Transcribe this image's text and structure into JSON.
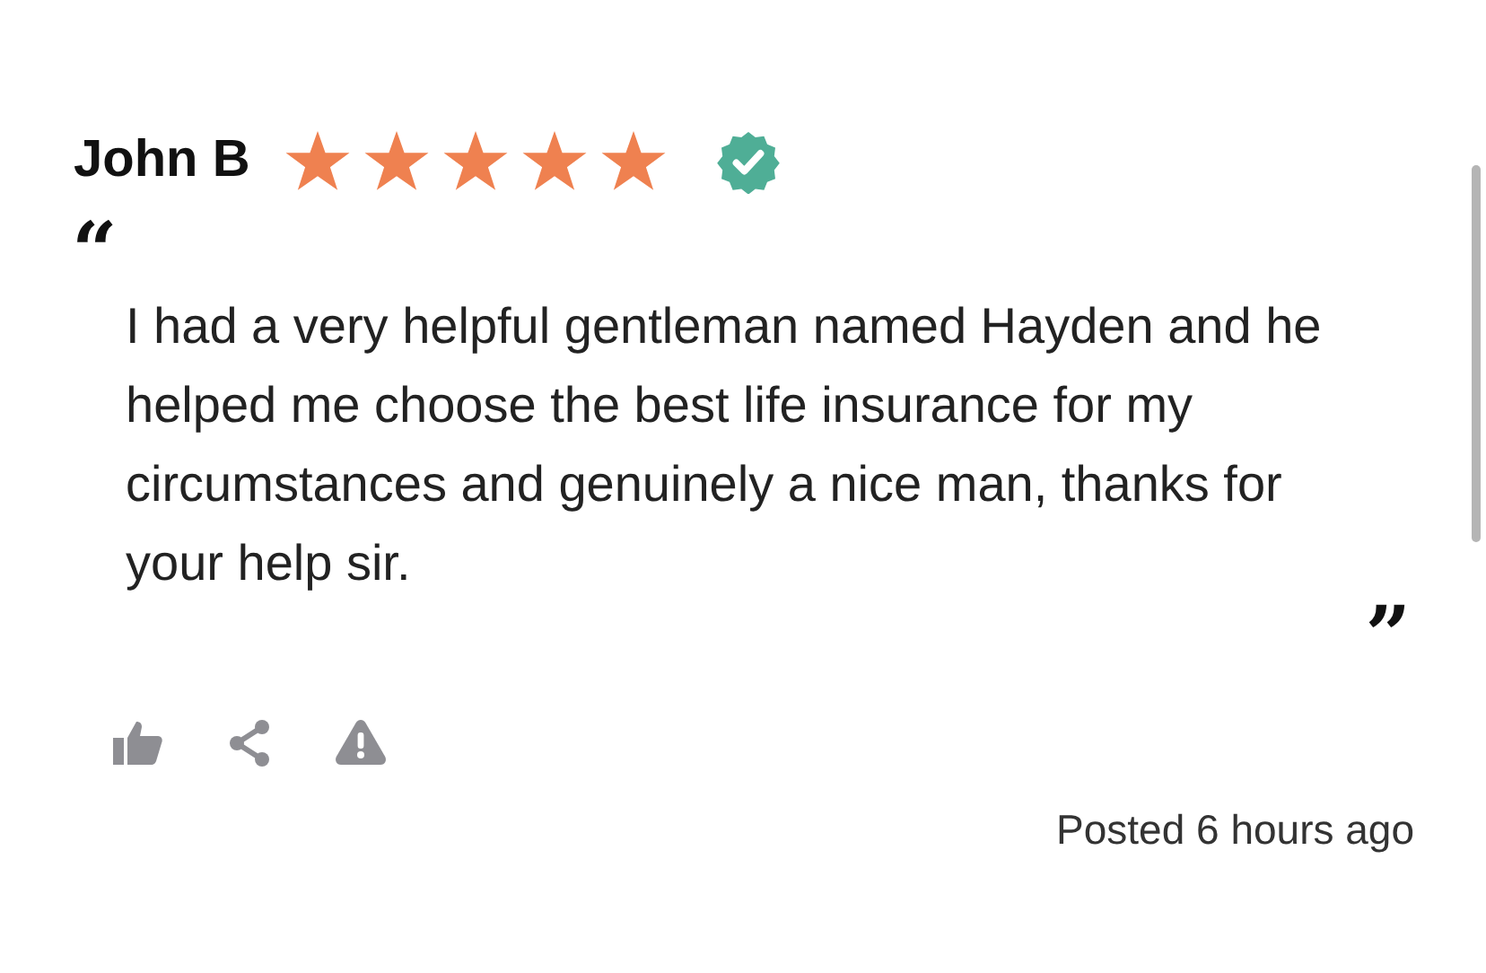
{
  "review": {
    "author": "John B",
    "stars": 5,
    "verified": true,
    "open_quote": "“",
    "text": "I had a very helpful gentleman named Hayden and he helped me choose the best life insurance for my circumstances and genuinely a nice man, thanks for your help sir.",
    "close_quote": "”",
    "posted": "Posted 6 hours ago"
  }
}
